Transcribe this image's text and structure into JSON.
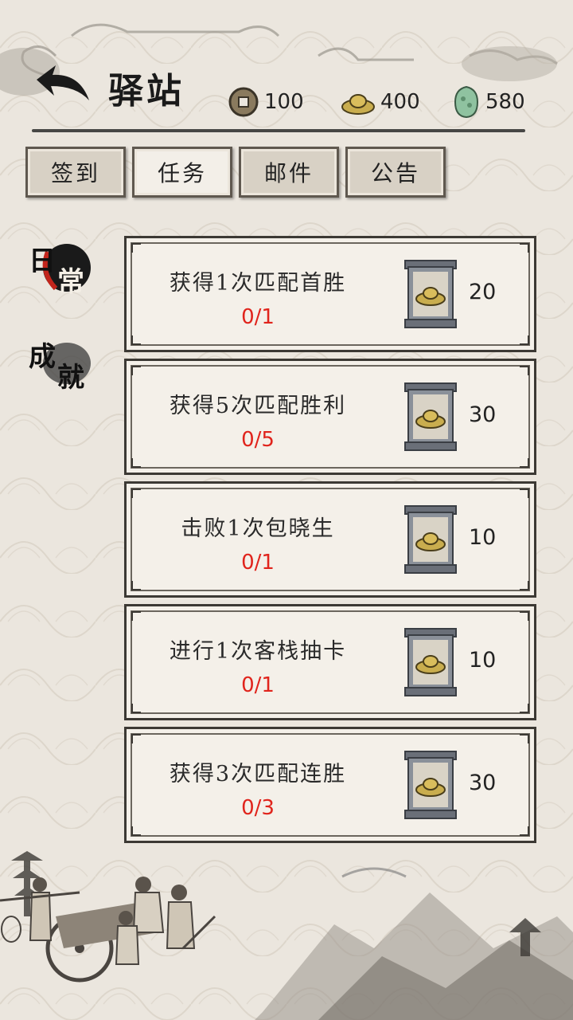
{
  "header": {
    "title": "驿站"
  },
  "resources": [
    {
      "icon": "copper-coin-icon",
      "value": "100"
    },
    {
      "icon": "gold-ingot-icon",
      "value": "400"
    },
    {
      "icon": "jade-icon",
      "value": "580"
    }
  ],
  "tabs": [
    {
      "label": "签到",
      "active": false
    },
    {
      "label": "任务",
      "active": true
    },
    {
      "label": "邮件",
      "active": false
    },
    {
      "label": "公告",
      "active": false
    }
  ],
  "side_tabs": [
    {
      "label_a": "日",
      "label_b": "常",
      "active": true
    },
    {
      "label_a": "成",
      "label_b": "就",
      "active": false
    }
  ],
  "tasks": [
    {
      "name": "获得1次匹配首胜",
      "progress": "0/1",
      "reward_icon": "gold-ingot-icon",
      "reward": "20"
    },
    {
      "name": "获得5次匹配胜利",
      "progress": "0/5",
      "reward_icon": "gold-ingot-icon",
      "reward": "30"
    },
    {
      "name": "击败1次包晓生",
      "progress": "0/1",
      "reward_icon": "gold-ingot-icon",
      "reward": "10"
    },
    {
      "name": "进行1次客栈抽卡",
      "progress": "0/1",
      "reward_icon": "gold-ingot-icon",
      "reward": "10"
    },
    {
      "name": "获得3次匹配连胜",
      "progress": "0/3",
      "reward_icon": "gold-ingot-icon",
      "reward": "30"
    }
  ],
  "colors": {
    "progress": "#e0241c",
    "ink": "#1a1a1a",
    "paper": "#ebe6de"
  }
}
